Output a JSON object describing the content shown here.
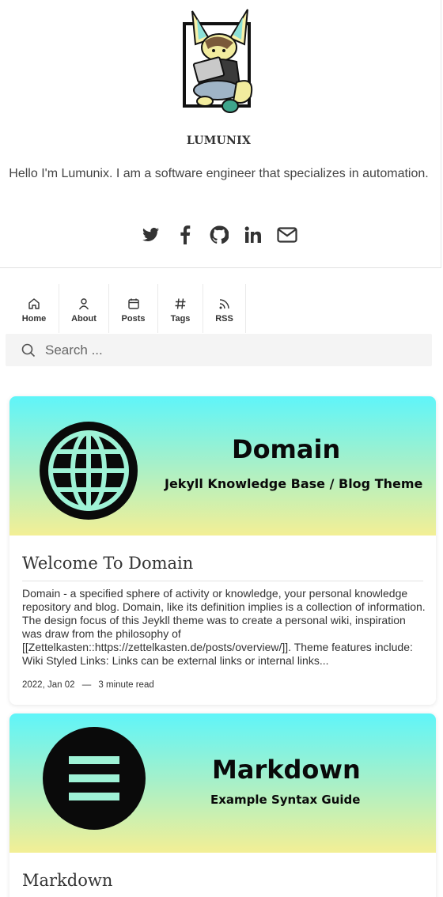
{
  "site": {
    "title": "LUMUNIX",
    "tagline": "Hello I'm Lumunix. I am a software engineer that specializes in automation."
  },
  "social": [
    "twitter-icon",
    "facebook-icon",
    "github-icon",
    "linkedin-icon",
    "email-icon"
  ],
  "nav": {
    "items": [
      {
        "label": "Home",
        "icon": "home-icon"
      },
      {
        "label": "About",
        "icon": "user-icon"
      },
      {
        "label": "Posts",
        "icon": "calendar-icon"
      },
      {
        "label": "Tags",
        "icon": "hash-icon"
      },
      {
        "label": "RSS",
        "icon": "rss-icon"
      }
    ]
  },
  "search": {
    "placeholder": "Search ..."
  },
  "posts": [
    {
      "banner_title": "Domain",
      "banner_subtitle": "Jekyll Knowledge Base / Blog Theme",
      "banner_icon": "globe-icon",
      "title": "Welcome To Domain",
      "excerpt": "Domain - a specified sphere of activity or knowledge, your personal knowledge repository and blog. Domain, like its definition implies is a collection of information. The design focus of this Jeykll theme was to create a personal wiki, inspiration was draw from the philosophy of [[Zettelkasten::https://zettelkasten.de/posts/overview/]]. Theme features include: Wiki Styled Links: Links can be external links or internal links...",
      "date": "2022, Jan 02",
      "separator": "—",
      "read_time": "3 minute read"
    },
    {
      "banner_title": "Markdown",
      "banner_subtitle": "Example Syntax Guide",
      "banner_icon": "menu-lines-icon",
      "title": "Markdown"
    }
  ],
  "colors": {
    "banner_top": "#5ff5f9",
    "banner_bottom": "#f3ef95",
    "text": "#333333",
    "search_bg": "#f4f4f4"
  }
}
